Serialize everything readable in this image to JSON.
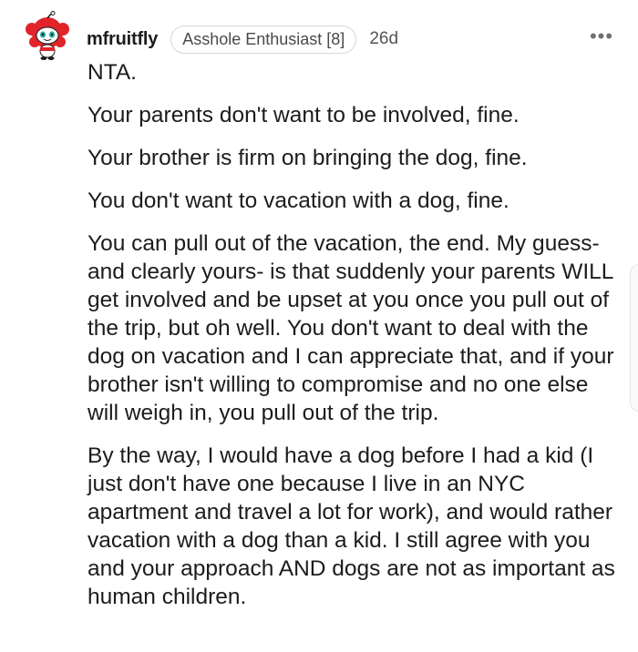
{
  "comment": {
    "username": "mfruitfly",
    "flair": "Asshole Enthusiast [8]",
    "age": "26d",
    "more_label": "•••",
    "avatar_icon": "snoo-avatar-icon",
    "paragraphs": [
      "NTA.",
      "Your parents don't want to be involved, fine.",
      "Your brother is firm on bringing the dog, fine.",
      "You don't want to vacation with a dog, fine.",
      "You can pull out of the vacation, the end. My guess- and clearly yours- is that suddenly your parents WILL get involved and be upset at you once you pull out of the trip, but oh well. You don't want to deal with the dog on vacation and I can appreciate that, and if your brother isn't willing to compromise and no one else will weigh in, you pull out of the trip.",
      "By the way, I would have a dog before I had a kid (I just don't have one because I live in an NYC apartment and travel a lot for work), and would rather vacation with a dog than a kid. I still agree with you and your approach AND dogs are not as important as human children."
    ]
  },
  "colors": {
    "text": "#1c1c1c",
    "meta": "#555555",
    "flair_border": "#d4d7d9",
    "avatar_red": "#e0242a",
    "avatar_teal": "#1fa89a"
  }
}
